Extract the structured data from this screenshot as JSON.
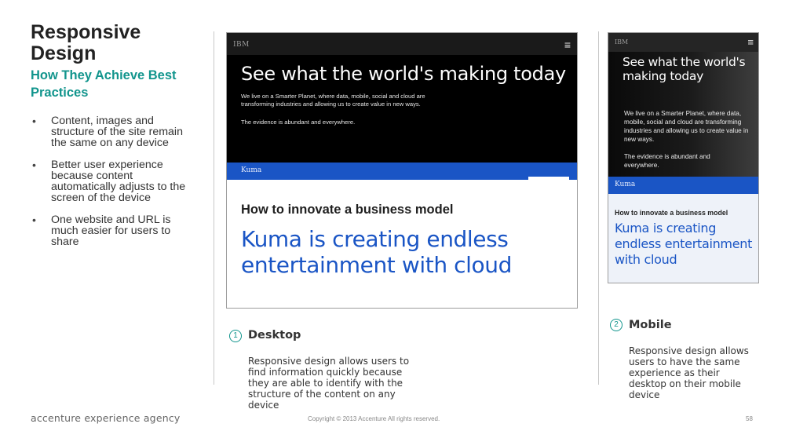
{
  "slide": {
    "title": "Responsive Design",
    "subtitle": "How They Achieve Best Practices",
    "bullets": [
      "Content, images and structure of the site remain the same on any device",
      "Better user experience because content automatically adjusts to the screen of the device",
      "One website and URL is much easier for users to share"
    ]
  },
  "desktop_mock": {
    "logo": "IBM",
    "menu_icon": "≡",
    "headline": "See what the world's making today",
    "description": "We live on a Smarter Planet, where data, mobile, social and cloud are transforming industries and allowing us to create value in new ways.",
    "evidence": "The evidence is abundant and everywhere.",
    "nav_label": "Kuma",
    "article_title": "How to innovate a business model",
    "article_body": "Kuma is creating endless entertainment with cloud"
  },
  "mobile_mock": {
    "logo": "IBM",
    "menu_icon": "≡",
    "headline": "See what the world's making today",
    "description": "We live on a Smarter Planet, where data, mobile, social and cloud are transforming industries and allowing us to create value in new ways.",
    "evidence": "The evidence is abundant and everywhere.",
    "nav_label": "Kuma",
    "article_title": "How to innovate a business model",
    "article_body": "Kuma is creating endless entertainment with cloud"
  },
  "captions": {
    "desktop": {
      "number": "1",
      "title": "Desktop",
      "text": "Responsive design allows users to find information quickly because they are able to identify with the structure of the content on any device"
    },
    "mobile": {
      "number": "2",
      "title": "Mobile",
      "text": "Responsive design allows users to have the same experience as their desktop on their mobile device"
    }
  },
  "footer": {
    "agency": "accenture experience agency",
    "copyright": "Copyright © 2013 Accenture  All rights reserved.",
    "page_number": "58"
  },
  "colors": {
    "accent": "#12958d",
    "ibm_blue": "#1a55c5",
    "hero_black": "#000000"
  }
}
